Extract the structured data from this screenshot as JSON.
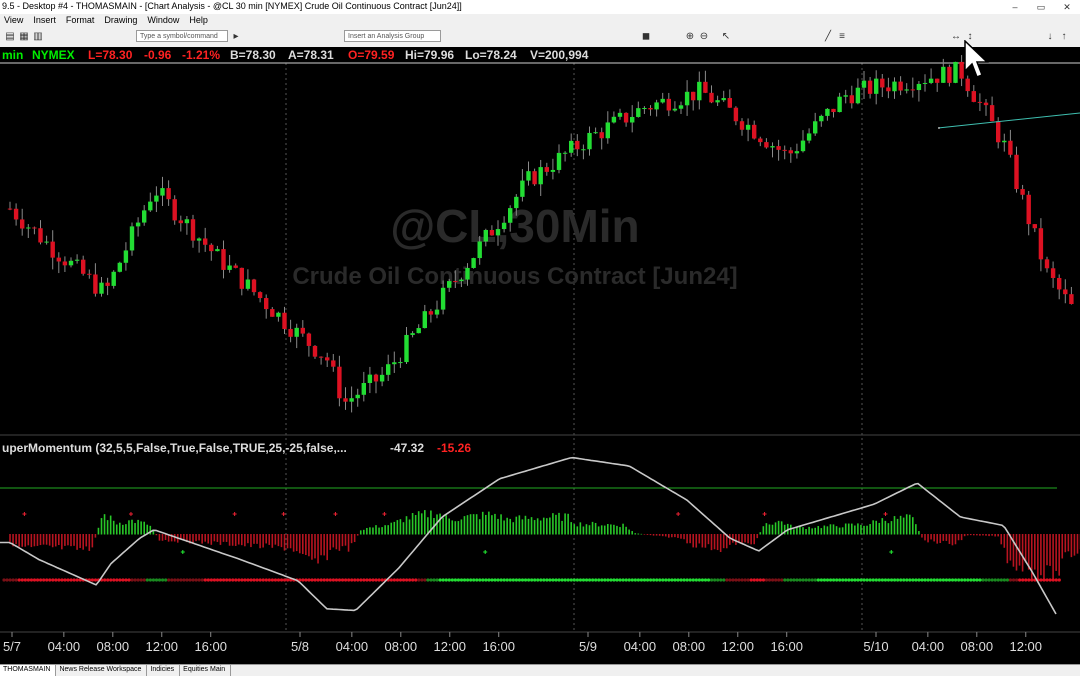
{
  "window": {
    "title": "9.5 - Desktop #4 - THOMASMAIN - [Chart Analysis - @CL 30 min [NYMEX] Crude Oil Continuous Contract [Jun24]]",
    "controls": [
      "–",
      "▭",
      "✕"
    ]
  },
  "menu": [
    "View",
    "Insert",
    "Format",
    "Drawing",
    "Window",
    "Help"
  ],
  "toolbar": {
    "symbol_placeholder": "Type a symbol/command",
    "group_placeholder": "Insert an Analysis Group"
  },
  "quote": {
    "interval": "min",
    "exchange": "NYMEX",
    "last": "L=78.30",
    "net_change": "-0.96",
    "pct_change": "-1.21%",
    "bid": "B=78.30",
    "ask": "A=78.31",
    "open": "O=79.59",
    "high": "Hi=79.96",
    "low": "Lo=78.24",
    "volume": "V=200,994"
  },
  "watermark": {
    "symbol": "@CL,30Min",
    "description": "Crude Oil Continuous Contract [Jun24]"
  },
  "indicator": {
    "name": "uperMomentum (32,5,5,False,True,False,TRUE,25,-25,false,...",
    "value1": "-47.32",
    "value2": "-15.26"
  },
  "colors": {
    "up": "#22dd33",
    "down": "#dd1122",
    "accent_green": "#00ee00",
    "accent_red": "#ff2222"
  },
  "time_axis": [
    "5/7",
    "04:00",
    "08:00",
    "12:00",
    "16:00",
    "5/8",
    "04:00",
    "08:00",
    "12:00",
    "16:00",
    "5/9",
    "04:00",
    "08:00",
    "12:00",
    "16:00",
    "5/10",
    "04:00",
    "08:00",
    "12:00"
  ],
  "tabs": [
    {
      "label": "THOMASMAIN",
      "active": true
    },
    {
      "label": "News Release Workspace",
      "active": false
    },
    {
      "label": "Indicies",
      "active": false
    },
    {
      "label": "Equities Main",
      "active": false
    }
  ],
  "chart_data": {
    "type": "candlestick",
    "symbol": "@CL",
    "interval": "30 min",
    "close_path": [
      [
        0.0,
        79.6
      ],
      [
        0.15,
        79.1
      ],
      [
        0.33,
        78.55
      ],
      [
        0.5,
        79.85
      ],
      [
        0.72,
        79.0
      ],
      [
        1.0,
        78.05
      ],
      [
        1.1,
        77.75
      ],
      [
        1.16,
        77.2
      ],
      [
        1.3,
        77.55
      ],
      [
        1.5,
        78.5
      ],
      [
        1.8,
        79.95
      ],
      [
        2.0,
        80.45
      ],
      [
        2.2,
        80.85
      ],
      [
        2.4,
        81.05
      ],
      [
        2.5,
        80.8
      ],
      [
        2.7,
        80.25
      ],
      [
        2.9,
        81.0
      ],
      [
        3.0,
        81.1
      ],
      [
        3.3,
        81.3
      ],
      [
        3.45,
        80.4
      ],
      [
        3.6,
        78.8
      ],
      [
        3.7,
        78.3
      ]
    ],
    "indicator_path": [
      [
        0.0,
        -0.1
      ],
      [
        0.1,
        -0.3
      ],
      [
        0.3,
        -0.6
      ],
      [
        0.35,
        -0.35
      ],
      [
        0.45,
        -0.05
      ],
      [
        0.5,
        0.05
      ],
      [
        0.8,
        -0.3
      ],
      [
        1.0,
        -0.55
      ],
      [
        1.1,
        -0.88
      ],
      [
        1.2,
        -0.9
      ],
      [
        1.35,
        -0.4
      ],
      [
        1.5,
        0.2
      ],
      [
        1.7,
        0.65
      ],
      [
        1.95,
        0.9
      ],
      [
        2.15,
        0.8
      ],
      [
        2.35,
        0.4
      ],
      [
        2.5,
        -0.05
      ],
      [
        2.6,
        -0.2
      ],
      [
        2.7,
        0.05
      ],
      [
        3.0,
        0.35
      ],
      [
        3.15,
        0.6
      ],
      [
        3.3,
        0.2
      ],
      [
        3.45,
        0.1
      ],
      [
        3.55,
        -0.45
      ],
      [
        3.65,
        -1.05
      ],
      [
        3.7,
        -1.1
      ]
    ],
    "price_range": [
      76.8,
      81.4
    ]
  }
}
